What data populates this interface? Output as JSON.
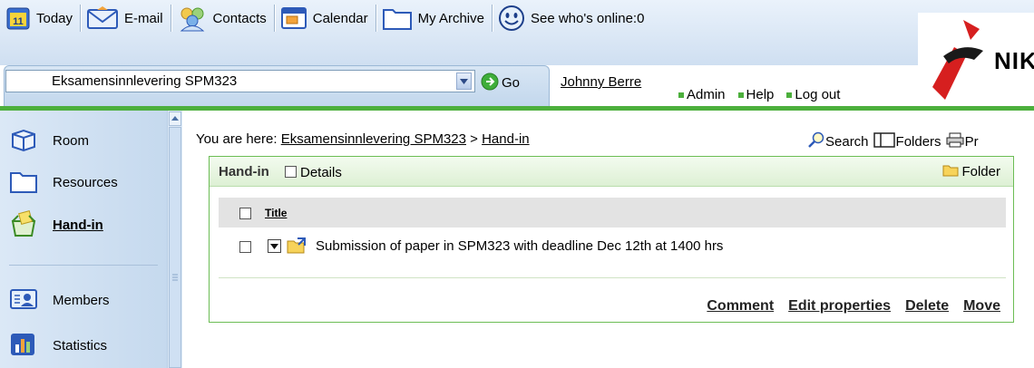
{
  "nav": {
    "today": "Today",
    "email": "E-mail",
    "contacts": "Contacts",
    "calendar": "Calendar",
    "archive": "My Archive",
    "online": "See who's online:0",
    "today_day": "11"
  },
  "logo": {
    "text": "NIK"
  },
  "room": {
    "selected": "Eksamensinnlevering SPM323",
    "go_label": "Go"
  },
  "user": {
    "name": "Johnny Berre",
    "admin": "Admin",
    "help": "Help",
    "logout": "Log out"
  },
  "sidebar": {
    "room": "Room",
    "resources": "Resources",
    "handin": "Hand-in",
    "members": "Members",
    "statistics": "Statistics"
  },
  "breadcrumb": {
    "prefix": "You are here:",
    "room": "Eksamensinnlevering SPM323",
    "sep": ">",
    "current": "Hand-in"
  },
  "top_actions": {
    "search": "Search",
    "folders": "Folders",
    "print": "Pr"
  },
  "panel": {
    "title": "Hand-in",
    "details": "Details",
    "folder": "Folder",
    "column_title": "Title",
    "items": [
      {
        "title": "Submission of paper in SPM323 with deadline Dec 12th at 1400 hrs"
      }
    ],
    "actions": {
      "comment": "Comment",
      "edit": "Edit properties",
      "delete": "Delete",
      "move": "Move"
    }
  },
  "colors": {
    "accent_green": "#4caf3c",
    "toolbar_blue": "#cfdff1",
    "logo_red": "#d61f1f"
  }
}
